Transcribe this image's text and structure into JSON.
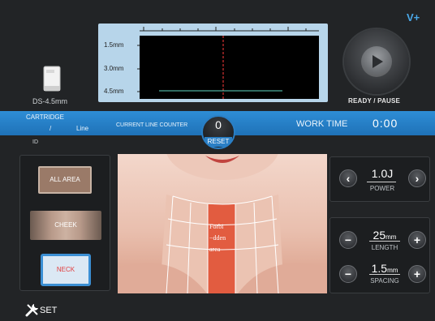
{
  "header": {
    "brand": "V+"
  },
  "cartridge": {
    "model": "DS-4.5mm",
    "title": "CARTRIDGE",
    "slash": "/",
    "line_label": "Line",
    "id_label": "ID"
  },
  "depth_monitor": {
    "depths": [
      "1.5mm",
      "3.0mm",
      "4.5mm"
    ],
    "cursor_color": "#ff3b3b",
    "line_color": "#5fd6c4"
  },
  "playback": {
    "label": "READY / PAUSE"
  },
  "counter": {
    "label": "CURRENT LINE COUNTER",
    "value": "0",
    "reset_label": "RESET"
  },
  "work_time": {
    "label": "WORK TIME",
    "value": "0:00"
  },
  "areas": {
    "all": "ALL AREA",
    "cheek": "CHEEK",
    "neck": "NECK"
  },
  "image": {
    "forbidden_text": [
      "Forbi",
      "−dden",
      "area"
    ]
  },
  "power": {
    "value": "1.0J",
    "label": "POWER"
  },
  "length": {
    "value": "25",
    "unit": "mm",
    "label": "LENGTH"
  },
  "spacing": {
    "value": "1.5",
    "unit": "mm",
    "label": "SPACING"
  },
  "settings": {
    "label": "SET"
  },
  "colors": {
    "accent_blue": "#2a7fc5",
    "background": "#222426",
    "forbidden_zone": "#e04a2c"
  }
}
